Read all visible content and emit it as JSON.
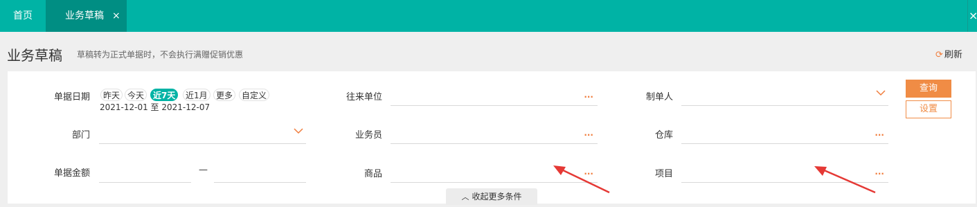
{
  "tabs": {
    "home": "首页",
    "active": "业务草稿",
    "close_glyph": "×"
  },
  "window_close_glyph": "×",
  "header": {
    "title": "业务草稿",
    "tip": "草稿转为正式单据时，不会执行满赠促销优惠",
    "refresh_label": "刷新"
  },
  "filters": {
    "date_label": "单据日期",
    "date_options": [
      "昨天",
      "今天",
      "近7天",
      "近1月",
      "更多",
      "自定义"
    ],
    "date_selected": "近7天",
    "date_range": "2021-12-01 至 2021-12-07",
    "partner_label": "往来单位",
    "creator_label": "制单人",
    "department_label": "部门",
    "salesman_label": "业务员",
    "warehouse_label": "仓库",
    "amount_label": "单据金额",
    "amount_separator": "—",
    "product_label": "商品",
    "project_label": "项目",
    "ellipsis": "···"
  },
  "buttons": {
    "query": "查询",
    "settings": "设置"
  },
  "collapse_label": "收起更多条件",
  "colors": {
    "topbar": "#00b3a5",
    "active_tab": "#008e83",
    "accent_orange": "#f08c45",
    "annotation_red": "#e53935"
  }
}
